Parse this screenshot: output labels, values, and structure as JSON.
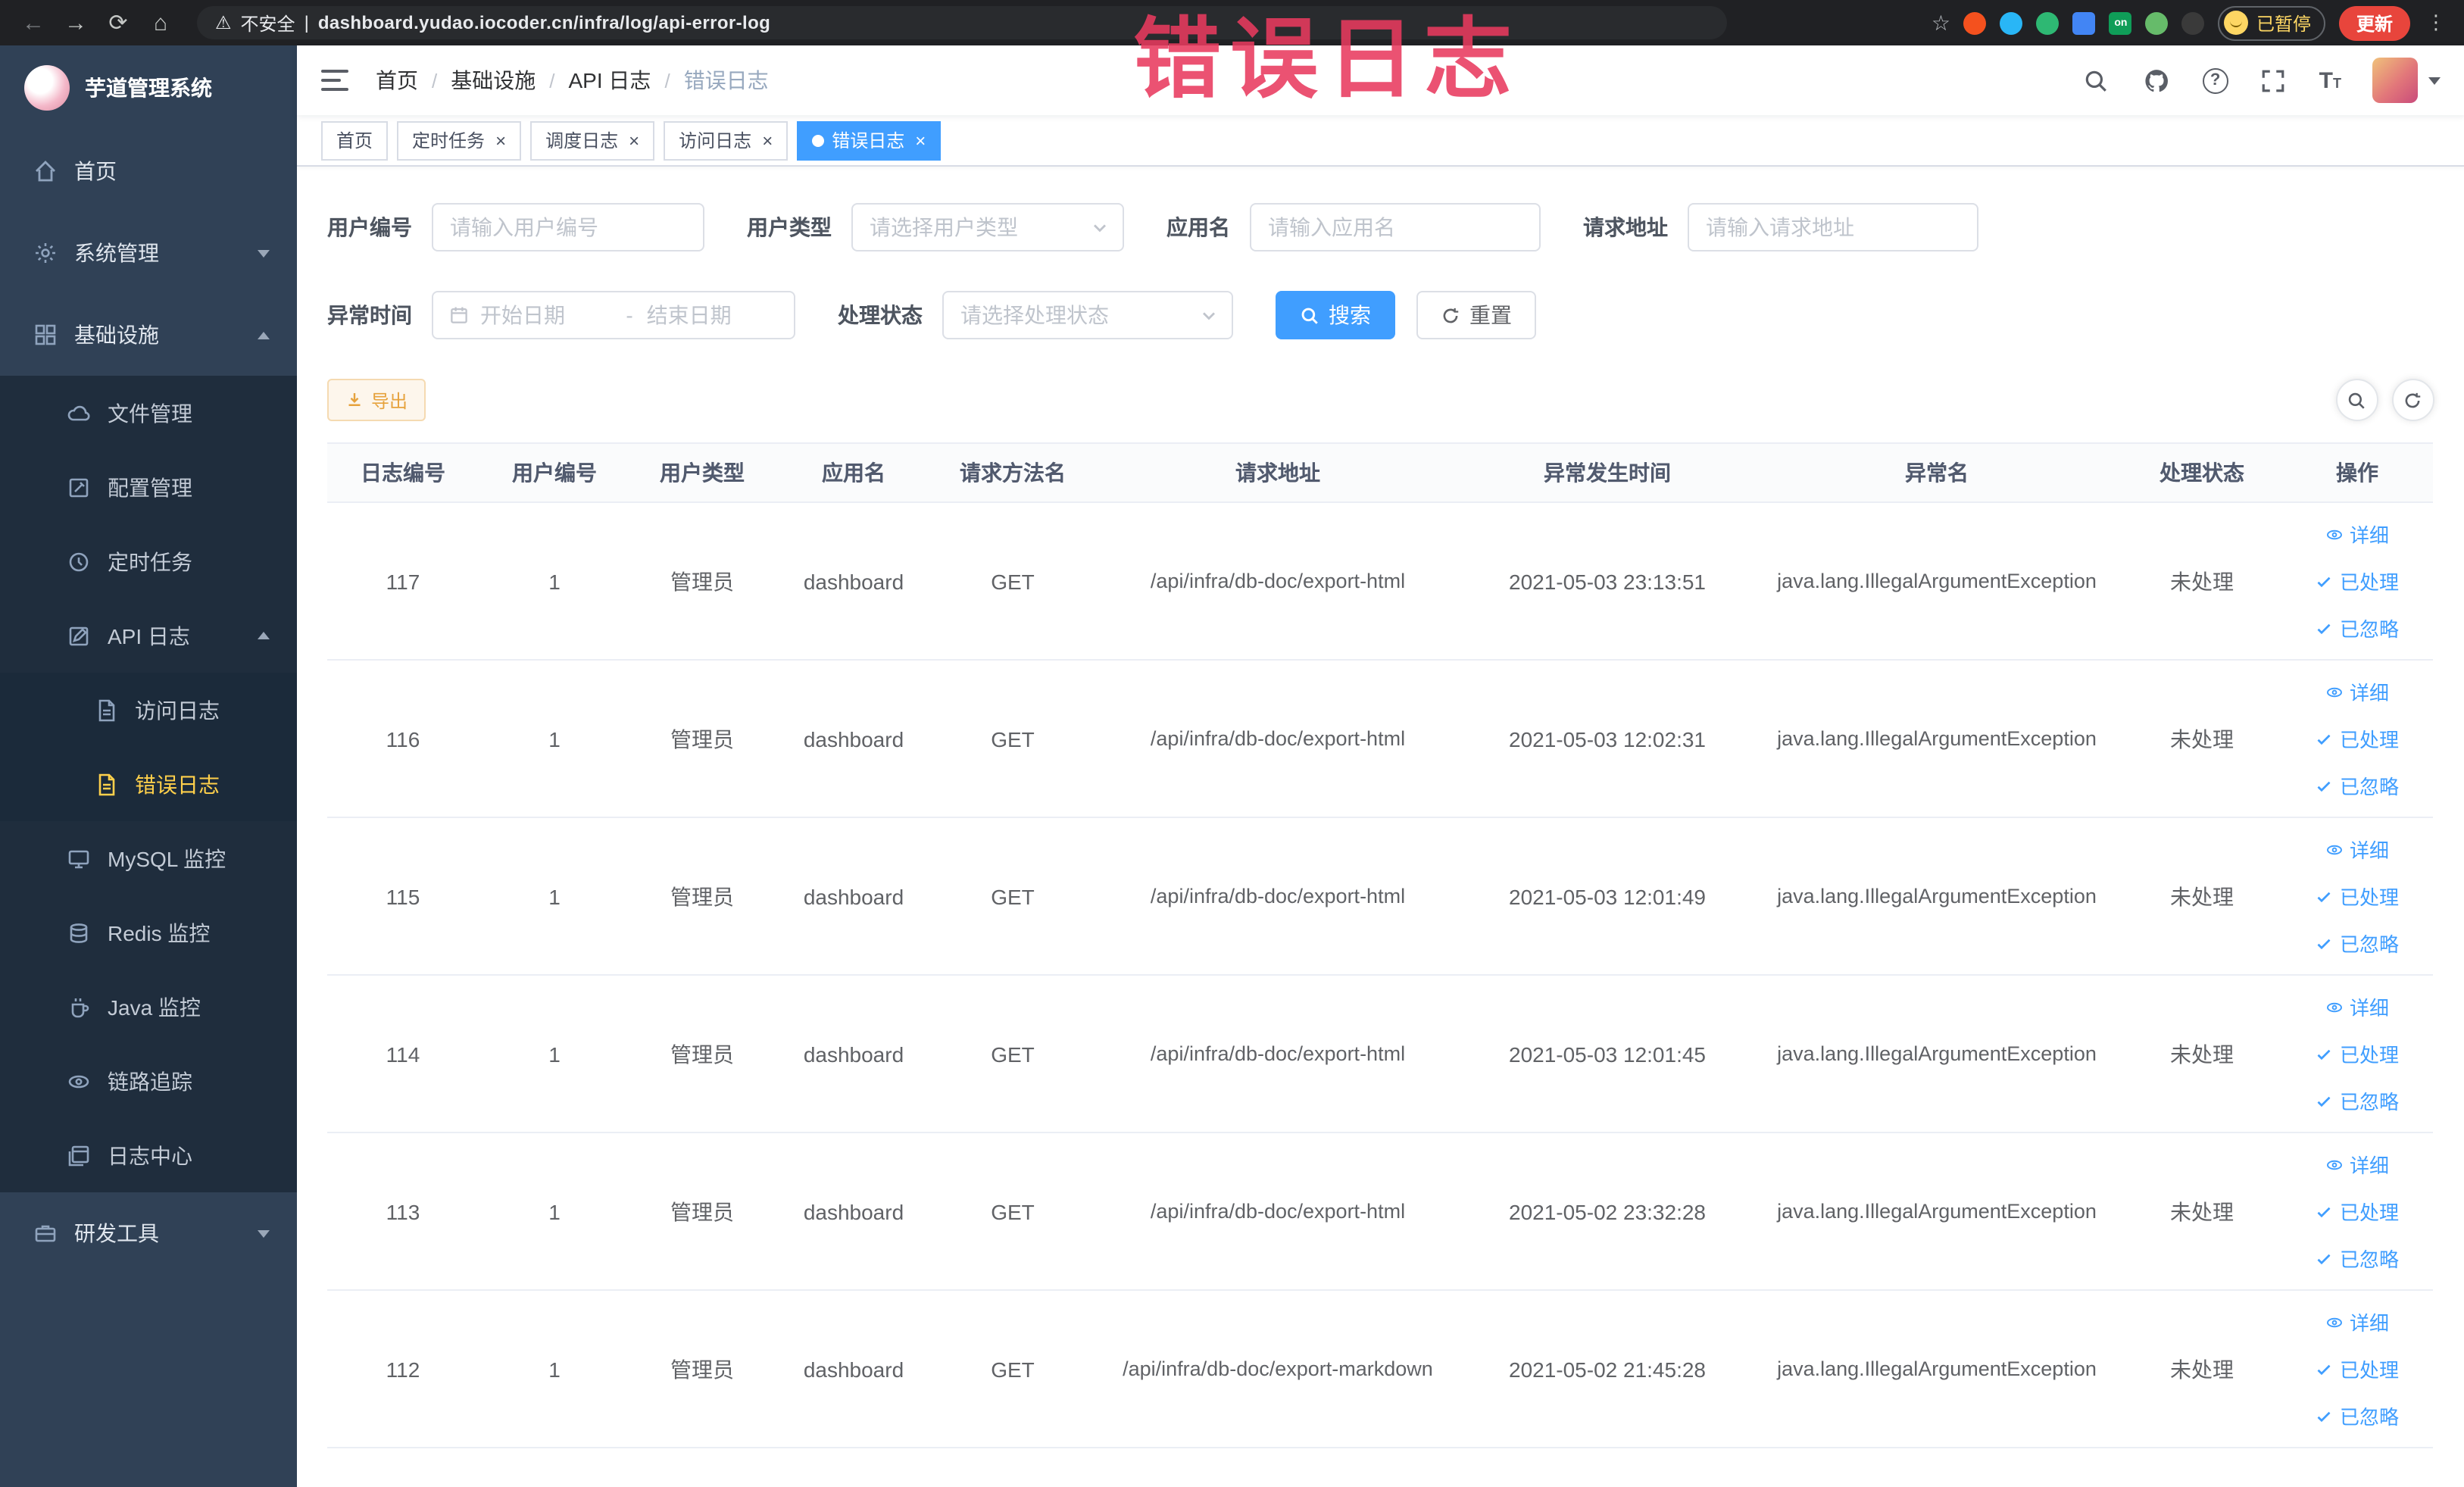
{
  "colors": {
    "accent": "#409eff",
    "sidebar_bg": "#304156",
    "submenu_bg": "#1f2d3d",
    "active_menu_text": "#ffd04b",
    "warning_button": "#e6a23c",
    "annotation_red": "#e83a5f",
    "chrome_bar": "#202124",
    "update_red": "#e8453c"
  },
  "annotation": {
    "text": "错误日志"
  },
  "browser": {
    "security_label": "不安全",
    "url": "dashboard.yudao.iocoder.cn/infra/log/api-error-log",
    "paused_badge": "已暂停",
    "update_button": "更新",
    "extension_badge_on": "on"
  },
  "sidebar": {
    "logo_title": "芋道管理系统",
    "menu": [
      {
        "label": "首页"
      },
      {
        "label": "系统管理"
      },
      {
        "label": "基础设施"
      },
      {
        "label": "文件管理"
      },
      {
        "label": "配置管理"
      },
      {
        "label": "定时任务"
      },
      {
        "label": "API 日志"
      },
      {
        "label": "访问日志"
      },
      {
        "label": "错误日志"
      },
      {
        "label": "MySQL 监控"
      },
      {
        "label": "Redis 监控"
      },
      {
        "label": "Java 监控"
      },
      {
        "label": "链路追踪"
      },
      {
        "label": "日志中心"
      },
      {
        "label": "研发工具"
      }
    ]
  },
  "topbar": {
    "breadcrumb": [
      "首页",
      "基础设施",
      "API 日志",
      "错误日志"
    ]
  },
  "tabs": [
    {
      "label": "首页"
    },
    {
      "label": "定时任务"
    },
    {
      "label": "调度日志"
    },
    {
      "label": "访问日志"
    },
    {
      "label": "错误日志"
    }
  ],
  "filters": {
    "user_id_label": "用户编号",
    "user_id_placeholder": "请输入用户编号",
    "user_type_label": "用户类型",
    "user_type_placeholder": "请选择用户类型",
    "app_name_label": "应用名",
    "app_name_placeholder": "请输入应用名",
    "request_url_label": "请求地址",
    "request_url_placeholder": "请输入请求地址",
    "exception_time_label": "异常时间",
    "date_start_placeholder": "开始日期",
    "date_separator": "-",
    "date_end_placeholder": "结束日期",
    "process_status_label": "处理状态",
    "process_status_placeholder": "请选择处理状态",
    "search_button": "搜索",
    "reset_button": "重置"
  },
  "toolbar": {
    "export_button": "导出"
  },
  "table": {
    "columns": [
      "日志编号",
      "用户编号",
      "用户类型",
      "应用名",
      "请求方法名",
      "请求地址",
      "异常发生时间",
      "异常名",
      "处理状态",
      "操作"
    ],
    "actions": [
      "详细",
      "已处理",
      "已忽略"
    ],
    "rows": [
      {
        "id": "117",
        "user_id": "1",
        "user_type": "管理员",
        "app": "dashboard",
        "method": "GET",
        "url": "/api/infra/db-doc/export-html",
        "time": "2021-05-03 23:13:51",
        "exception": "java.lang.IllegalArgumentException",
        "status": "未处理"
      },
      {
        "id": "116",
        "user_id": "1",
        "user_type": "管理员",
        "app": "dashboard",
        "method": "GET",
        "url": "/api/infra/db-doc/export-html",
        "time": "2021-05-03 12:02:31",
        "exception": "java.lang.IllegalArgumentException",
        "status": "未处理"
      },
      {
        "id": "115",
        "user_id": "1",
        "user_type": "管理员",
        "app": "dashboard",
        "method": "GET",
        "url": "/api/infra/db-doc/export-html",
        "time": "2021-05-03 12:01:49",
        "exception": "java.lang.IllegalArgumentException",
        "status": "未处理"
      },
      {
        "id": "114",
        "user_id": "1",
        "user_type": "管理员",
        "app": "dashboard",
        "method": "GET",
        "url": "/api/infra/db-doc/export-html",
        "time": "2021-05-03 12:01:45",
        "exception": "java.lang.IllegalArgumentException",
        "status": "未处理"
      },
      {
        "id": "113",
        "user_id": "1",
        "user_type": "管理员",
        "app": "dashboard",
        "method": "GET",
        "url": "/api/infra/db-doc/export-html",
        "time": "2021-05-02 23:32:28",
        "exception": "java.lang.IllegalArgumentException",
        "status": "未处理"
      },
      {
        "id": "112",
        "user_id": "1",
        "user_type": "管理员",
        "app": "dashboard",
        "method": "GET",
        "url": "/api/infra/db-doc/export-markdown",
        "time": "2021-05-02 21:45:28",
        "exception": "java.lang.IllegalArgumentException",
        "status": "未处理"
      }
    ]
  }
}
